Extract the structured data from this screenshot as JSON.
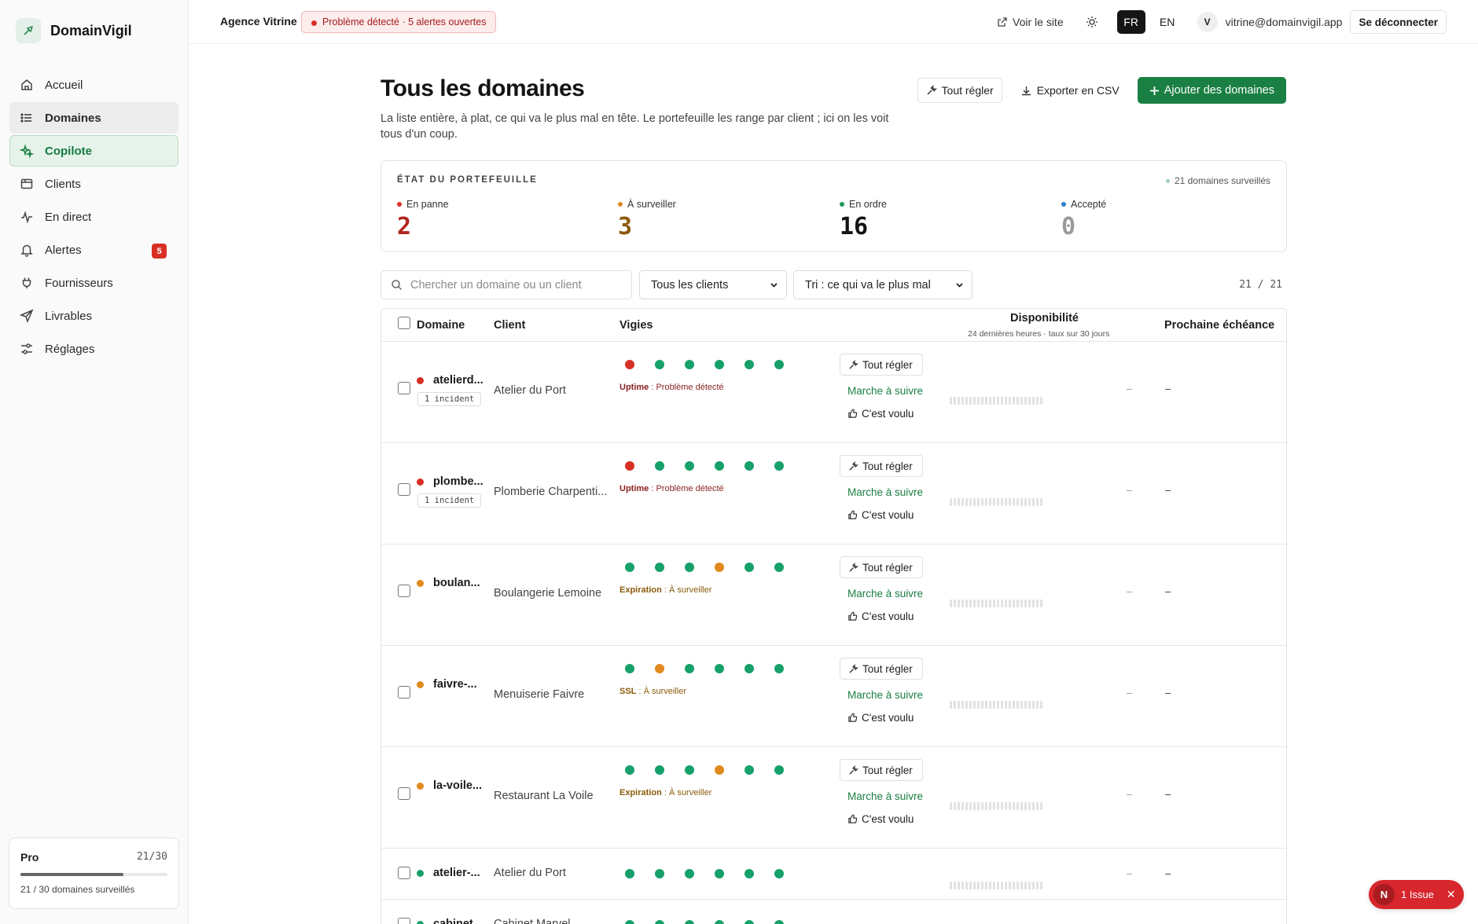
{
  "app": {
    "name": "DomainVigil"
  },
  "sidebar": {
    "items": [
      {
        "label": "Accueil",
        "icon": "home-icon"
      },
      {
        "label": "Domaines",
        "icon": "list-icon"
      },
      {
        "label": "Copilote",
        "icon": "sparkle-icon"
      },
      {
        "label": "Clients",
        "icon": "folder-icon"
      },
      {
        "label": "En direct",
        "icon": "pulse-icon"
      },
      {
        "label": "Alertes",
        "icon": "bell-icon",
        "badge": "5"
      },
      {
        "label": "Fournisseurs",
        "icon": "plug-icon"
      },
      {
        "label": "Livrables",
        "icon": "send-icon"
      },
      {
        "label": "Réglages",
        "icon": "sliders-icon"
      }
    ],
    "plan": {
      "name": "Pro",
      "count": "21/30",
      "progress": 0.7,
      "text": "21 / 30 domaines surveillés"
    }
  },
  "topbar": {
    "agency": "Agence Vitrine",
    "alert": "Problème détecté · 5 alertes ouvertes",
    "view_site": "Voir le site",
    "lang_fr": "FR",
    "lang_en": "EN",
    "avatar": "V",
    "email": "vitrine@domainvigil.app",
    "logout": "Se déconnecter"
  },
  "main": {
    "title": "Tous les domaines",
    "description": "La liste entière, à plat, ce qui va le plus mal en tête. Le portefeuille les range par client ; ici on les voit tous d'un coup.",
    "btn_fix_all": "Tout régler",
    "btn_export": "Exporter en CSV",
    "btn_add": "Ajouter des domaines"
  },
  "portfolio": {
    "heading": "ÉTAT DU PORTEFEUILLE",
    "total": "21 domaines surveillés",
    "stats": [
      {
        "label": "En panne",
        "value": "2",
        "color": "#b3261e",
        "dot": "#d93025"
      },
      {
        "label": "À surveiller",
        "value": "3",
        "color": "#8a5a0b",
        "dot": "#e08a1e"
      },
      {
        "label": "En ordre",
        "value": "16",
        "color": "#141414",
        "dot": "#1a9a5c"
      },
      {
        "label": "Accepté",
        "value": "0",
        "color": "#9a9a9a",
        "dot": "#2f7ec9"
      }
    ]
  },
  "filters": {
    "search_placeholder": "Chercher un domaine ou un client",
    "client_select": "Tous les clients",
    "sort_select": "Tri : ce qui va le plus mal",
    "count": "21 / 21"
  },
  "table": {
    "headers": {
      "domain": "Domaine",
      "client": "Client",
      "vigies": "Vigies",
      "availability": "Disponibilité",
      "availability_sub": "24 dernières heures · taux sur 30 jours",
      "next": "Prochaine échéance"
    },
    "actions": {
      "fix": "Tout régler",
      "follow": "Marche à suivre",
      "ok": "C'est voulu"
    },
    "dash": "–",
    "rows": [
      {
        "domain": "atelierd...",
        "client": "Atelier du Port",
        "status": "red",
        "incident": "1 incident",
        "vigies": [
          "red",
          "green",
          "green",
          "green",
          "green",
          "green"
        ],
        "check": "Uptime",
        "check_status": " : Problème détecté",
        "status_color": "#8a1f1f"
      },
      {
        "domain": "plombe...",
        "client": "Plomberie Charpenti...",
        "status": "red",
        "incident": "1 incident",
        "vigies": [
          "red",
          "green",
          "green",
          "green",
          "green",
          "green"
        ],
        "check": "Uptime",
        "check_status": " : Problème détecté",
        "status_color": "#8a1f1f"
      },
      {
        "domain": "boulan...",
        "client": "Boulangerie Lemoine",
        "status": "orange",
        "incident": "",
        "vigies": [
          "green",
          "green",
          "green",
          "orange",
          "green",
          "green"
        ],
        "check": "Expiration",
        "check_status": " : À surveiller",
        "status_color": "#8a5a0b"
      },
      {
        "domain": "faivre-...",
        "client": "Menuiserie Faivre",
        "status": "orange",
        "incident": "",
        "vigies": [
          "green",
          "orange",
          "green",
          "green",
          "green",
          "green"
        ],
        "check": "SSL",
        "check_status": " : À surveiller",
        "status_color": "#8a5a0b"
      },
      {
        "domain": "la-voile...",
        "client": "Restaurant La Voile",
        "status": "orange",
        "incident": "",
        "vigies": [
          "green",
          "green",
          "green",
          "orange",
          "green",
          "green"
        ],
        "check": "Expiration",
        "check_status": " : À surveiller",
        "status_color": "#8a5a0b"
      },
      {
        "domain": "atelier-...",
        "client": "Atelier du Port",
        "status": "green",
        "incident": "",
        "vigies": [
          "green",
          "green",
          "green",
          "green",
          "green",
          "green"
        ],
        "check": "",
        "check_status": "",
        "status_color": "#333"
      },
      {
        "domain": "cabinet...",
        "client": "Cabinet Marvel",
        "status": "green",
        "incident": "",
        "vigies": [
          "green",
          "green",
          "green",
          "green",
          "green",
          "green"
        ],
        "check": "",
        "check_status": "",
        "status_color": "#333"
      }
    ]
  },
  "toast": {
    "letter": "N",
    "label": "1 Issue"
  },
  "colors": {
    "red": "#d93025",
    "orange": "#e08a1e",
    "green": "#16a06a",
    "brand": "#1a7f43"
  }
}
